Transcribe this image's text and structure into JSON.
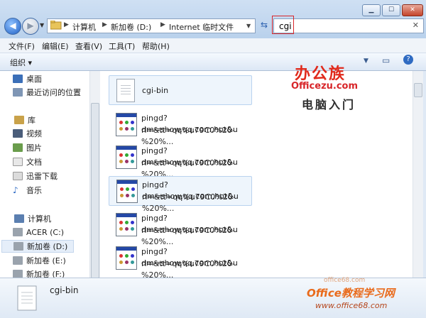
{
  "address": {
    "segments": [
      "计算机",
      "新加卷 (D:)",
      "Internet 临时文件"
    ]
  },
  "search": {
    "value": "cgi"
  },
  "menubar": [
    "文件(F)",
    "编辑(E)",
    "查看(V)",
    "工具(T)",
    "帮助(H)"
  ],
  "toolbar": {
    "organize_label": "组织 ▾"
  },
  "nav": {
    "favorites": [
      "桌面",
      "最近访问的位置"
    ],
    "library_header": "库",
    "library": [
      "视频",
      "图片",
      "文档",
      "迅雷下载",
      "音乐"
    ],
    "computer_header": "计算机",
    "drives": [
      "ACER (C:)",
      "新加卷 (D:)",
      "新加卷 (E:)",
      "新加卷 (F:)"
    ]
  },
  "files": [
    {
      "name": "cgi-bin",
      "type": "folder-file"
    },
    {
      "line1": "pingd?dm=show.qq.com.hot&u",
      "line2": "rl=&tt=qq%u79C0%20-%20%..."
    },
    {
      "line1": "pingd?dm=show.qq.com.hot&u",
      "line2": "rl=&tt=qq%u79C0%20-%20%..."
    },
    {
      "line1": "pingd?dm=show.qq.com.hot&u",
      "line2": "rl=&tt=qq%u79C0%20-%20%..."
    },
    {
      "line1": "pingd?dm=show.qq.com.hot&u",
      "line2": "rl=&tt=qq%u79C0%20-%20%..."
    },
    {
      "line1": "pingd?dm=show.qq.com.hot&u",
      "line2": "rl=&tt=qq%u79C0%20-%20%..."
    }
  ],
  "details": {
    "name": "cgi-bin"
  },
  "logo": {
    "line1": "办公族",
    "line2": "Officezu.com",
    "line3": "电脑入门"
  },
  "watermark": {
    "top": "office68.com",
    "main": "Office教程学习网",
    "url": "www.office68.com"
  },
  "colors": {
    "search_highlight": "#d8262a",
    "accent": "#2d62b0"
  }
}
